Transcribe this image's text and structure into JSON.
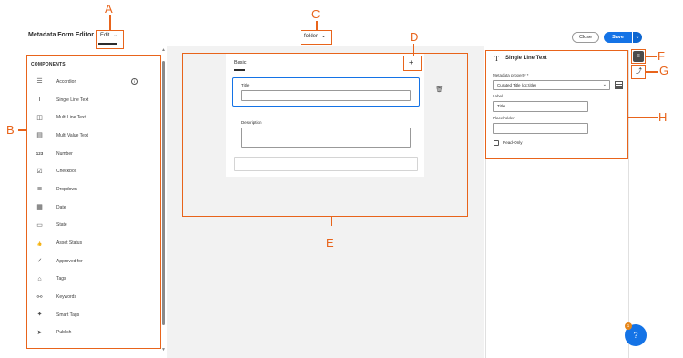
{
  "header": {
    "app_title": "Metadata Form Editor",
    "mode_label": "Edit",
    "folder_label": "folder",
    "close_label": "Close",
    "save_label": "Save"
  },
  "components": {
    "heading": "COMPONENTS",
    "items": [
      {
        "label": "Accordion",
        "icon": "accordion-icon",
        "glyph": "☰"
      },
      {
        "label": "Single Line Text",
        "icon": "text-icon",
        "glyph": "T"
      },
      {
        "label": "Multi Line Text",
        "icon": "multiline-icon",
        "glyph": "◫"
      },
      {
        "label": "Multi Value Text",
        "icon": "multivalue-icon",
        "glyph": "▤"
      },
      {
        "label": "Number",
        "icon": "number-icon",
        "glyph": "123"
      },
      {
        "label": "Checkbox",
        "icon": "checkbox-icon",
        "glyph": "☑"
      },
      {
        "label": "Dropdown",
        "icon": "dropdown-icon",
        "glyph": "≣"
      },
      {
        "label": "Date",
        "icon": "date-icon",
        "glyph": "▦"
      },
      {
        "label": "State",
        "icon": "state-icon",
        "glyph": "▭"
      },
      {
        "label": "Asset Status",
        "icon": "thumbs-up-icon",
        "glyph": "👍"
      },
      {
        "label": "Approved for",
        "icon": "approved-icon",
        "glyph": "✓"
      },
      {
        "label": "Tags",
        "icon": "tag-icon",
        "glyph": "⌂"
      },
      {
        "label": "Keywords",
        "icon": "keywords-icon",
        "glyph": "⚯"
      },
      {
        "label": "Smart Tags",
        "icon": "smart-tag-icon",
        "glyph": "✦"
      },
      {
        "label": "Publish",
        "icon": "publish-icon",
        "glyph": "➤"
      }
    ]
  },
  "canvas": {
    "tab_label": "Basic",
    "fields": [
      {
        "label": "Title"
      },
      {
        "label": "Description"
      }
    ]
  },
  "properties": {
    "title": "Single Line Text",
    "metadata_property_label": "Metadata property",
    "metadata_property_value": "Curated Title (dc:title)",
    "label_label": "Label",
    "label_value": "Title",
    "placeholder_label": "Placeholder",
    "placeholder_value": "",
    "readonly_label": "Read-Only"
  },
  "annotations": {
    "A": "A",
    "B": "B",
    "C": "C",
    "D": "D",
    "E": "E",
    "F": "F",
    "G": "G",
    "H": "H"
  },
  "colors": {
    "accent": "#1473e6",
    "annotation": "#e8641b"
  }
}
